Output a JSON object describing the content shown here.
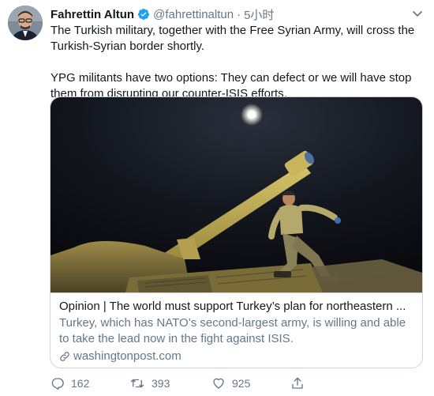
{
  "tweet": {
    "author_name": "Fahrettin Altun",
    "handle": "@fahrettinaltun",
    "separator": "·",
    "time": "5小时",
    "paragraphs": [
      "The Turkish military, together with the Free Syrian Army, will cross the Turkish-Syrian border shortly.",
      "YPG militants have two options: They can defect or we will have stop them from disrupting our counter-ISIS  efforts."
    ]
  },
  "card": {
    "title": "Opinion | The world must support Turkey’s plan for northeastern ...",
    "description": "Turkey, which has NATO’s second-largest army, is willing and able to take the lead now in the fight against ISIS.",
    "domain": "washingtonpost.com"
  },
  "actions": {
    "reply_count": "162",
    "retweet_count": "393",
    "like_count": "925"
  },
  "colors": {
    "verified": "#1da1f2",
    "secondary_text": "#657786",
    "border": "#ccd6dd"
  },
  "icons": {
    "verified": "verified-badge-icon",
    "caret": "chevron-down-icon",
    "link": "link-icon",
    "reply": "reply-icon",
    "retweet": "retweet-icon",
    "like": "heart-icon",
    "share": "share-icon"
  }
}
